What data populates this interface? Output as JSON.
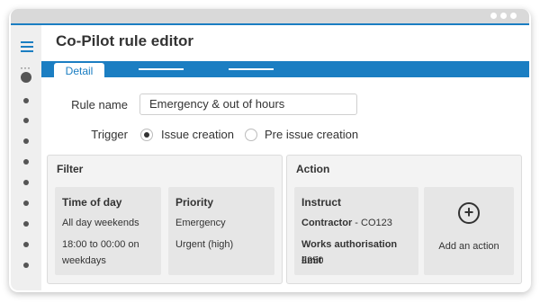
{
  "app": {
    "title": "Co-Pilot rule editor"
  },
  "tabs": [
    {
      "label": "Detail"
    }
  ],
  "form": {
    "rule_name_label": "Rule name",
    "rule_name_value": "Emergency & out of hours",
    "trigger_label": "Trigger",
    "trigger_options": [
      {
        "label": "Issue creation",
        "checked": true
      },
      {
        "label": "Pre issue creation",
        "checked": false
      }
    ]
  },
  "filter": {
    "title": "Filter",
    "time_of_day": {
      "title": "Time of day",
      "line1": "All day weekends",
      "line2": "18:00 to 00:00 on",
      "line3": "weekdays"
    },
    "priority": {
      "title": "Priority",
      "line1": "Emergency",
      "line2": "Urgent (high)"
    }
  },
  "action": {
    "title": "Action",
    "instruct": {
      "title": "Instruct",
      "contractor_label": "Contractor",
      "contractor_value": " - CO123",
      "limit_label": "Works authorisation limit",
      "limit_value": "£250"
    },
    "add_action_label": "Add an action"
  },
  "colors": {
    "accent": "#1b7ec2",
    "sidebar": "#efefef",
    "card": "#e6e6e6"
  },
  "icons": {
    "menu": "hamburger-icon",
    "more": "ellipsis-icon",
    "add": "plus-circle-icon"
  }
}
